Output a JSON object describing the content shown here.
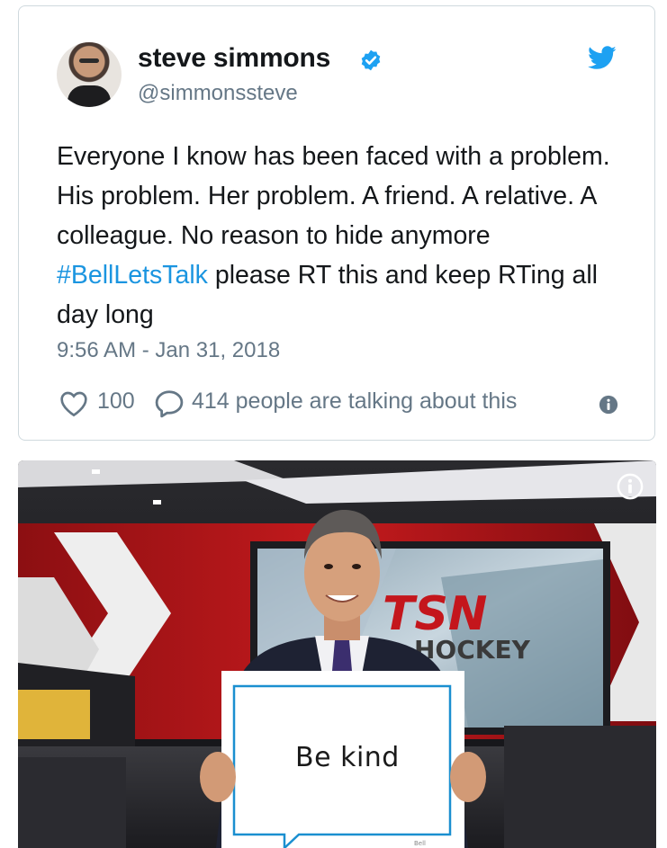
{
  "tweet": {
    "author": {
      "display_name": "steve simmons",
      "username": "@simmonssteve",
      "verified": true,
      "avatar_icon": "avatar-photo"
    },
    "text_segments": [
      "Everyone I know has been faced with a problem. His problem. Her problem. A friend. A relative. A colleague. No reason to hide anymore ",
      "#BellLetsTalk",
      " please RT this and keep RTing all day long"
    ],
    "hashtag": "#BellLetsTalk",
    "timestamp": "9:56 AM - Jan 31, 2018",
    "likes": "100",
    "talking": "414 people are talking about this",
    "icons": {
      "logo": "twitter-bird-icon",
      "like": "heart-icon",
      "reply": "comment-bubble-icon",
      "info": "info-icon"
    }
  },
  "photo": {
    "sign_text": "Be kind",
    "studio_logo_text": "TSN",
    "studio_sub_text": "HOCKEY",
    "info_icon": "info-icon"
  },
  "colors": {
    "link": "#1b95e0",
    "secondary_text": "#657786",
    "twitter_blue": "#1da1f2",
    "border": "#cfd9de"
  }
}
